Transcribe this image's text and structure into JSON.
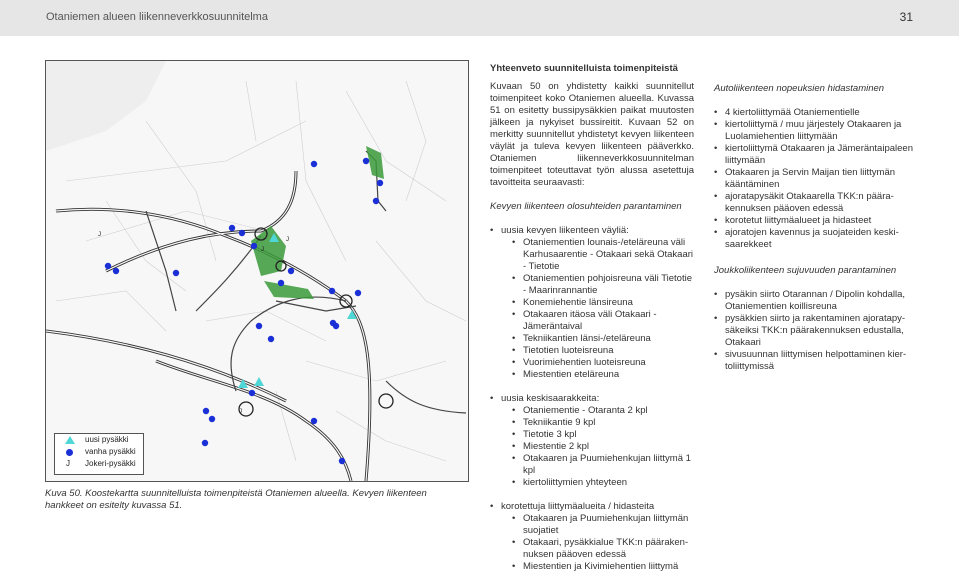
{
  "header": {
    "title": "Otaniemen alueen liikenneverkkosuunnitelma",
    "page_number": "31"
  },
  "legend": {
    "items": [
      {
        "symbol": "triangle-cyan",
        "label": "uusi pysäkki"
      },
      {
        "symbol": "dot-blue",
        "label": "vanha pysäkki"
      },
      {
        "symbol": "J",
        "label": "Jokeri-pysäkki"
      }
    ]
  },
  "caption": {
    "label": "Kuva 50.",
    "text": "Koostekartta suunnitelluista toimenpiteistä Otaniemen alueella. Kevyen liikenteen hankkeet on esitelty kuvassa 51."
  },
  "column2": {
    "heading": "Yhteenveto suunnitelluista toimenpiteistä",
    "para1": "Kuvaan 50 on yhdistetty kaikki suunnitellut toimenpiteet koko Otaniemen alueella. Kuvassa 51 on esitetty bussipysäkkien paikat muutosten jälkeen ja nykyiset bussireitit. Kuvaan 52 on merkitty suunnitellut yhdistetyt kevyen liikenteen väylät ja tuleva kevyen liikenteen pääverkko. Otaniemen liikenneverkkosuunnitelman toimenpiteet toteuttavat työn alussa asetettuja tavoitteita seuraavasti:",
    "subheading": "Kevyen liikenteen olosuhteiden parantaminen",
    "item1": "uusia kevyen liikenteen väyliä:",
    "item1_sub": [
      "Otaniementien lounais-/etelä­reuna väli Karhusaarentie - Otakaari sekä Otakaari - Tietotie",
      "Otaniementien pohjoisreuna väli Tietotie - Maarinrannantie",
      "Konemiehentie länsireuna",
      "Otakaaren itäosa väli Otakaari - Jämeräntaival",
      "Tekniikantien länsi-/eteläreuna",
      "Tietotien luoteisreuna",
      "Vuorimiehentien luoteisreuna",
      "Miestentien eteläreuna"
    ],
    "item2": "uusia keskisaarakkeita:",
    "item2_sub": [
      "Otaniementie - Otaranta 2 kpl",
      "Tekniikantie 9 kpl",
      "Tietotie 3 kpl",
      "Miestentie 2 kpl",
      "Otakaaren ja Puumiehenkujan liittymä 1 kpl",
      "kiertoliittymien yhteyteen"
    ],
    "item3": "korotettuja liittymäalueita / hidasteita",
    "item3_sub": [
      "Otakaaren ja Puumiehenkujan liittymän suojatiet",
      "Otakaari, pysäkkialue TKK:n pääraken­nuksen pääoven edessä",
      "Miestentien ja Kivimiehentien liittymä"
    ]
  },
  "column3": {
    "heading1": "Autoliikenteen nopeuksien hidastaminen",
    "list1": [
      "4 kiertoliittymää Otaniementielle",
      "kiertoliittymä / muu järjestely Otakaaren ja Luolamiehentien liittymään",
      "kiertoliittymä Otakaaren ja Jämeräntaipa­leen liittymään",
      "Otakaaren ja Servin Maijan tien liittymän kääntäminen",
      "ajoratapysäkit Otakaarella TKK:n päära­kennuksen pääoven edessä",
      "korotetut liittymäalueet ja hidasteet",
      "ajoratojen kavennus ja suojateiden keski­saarekkeet"
    ],
    "heading2": "Joukkoliikenteen sujuvuuden parantaminen",
    "list2": [
      "pysäkin siirto Otarannan / Dipolin kohdalla, Otaniementien koillisreuna",
      "pysäkkien siirto ja rakentaminen ajoratapy­säkeiksi TKK:n päärakennuksen edustalla, Otakaari",
      "sivusuunnan liittymisen helpottaminen kier­toliittymissä"
    ]
  },
  "colors": {
    "new_stop": "#4fd6d6",
    "old_stop": "#1a2fd6",
    "green_area": "#3a9a3a"
  }
}
